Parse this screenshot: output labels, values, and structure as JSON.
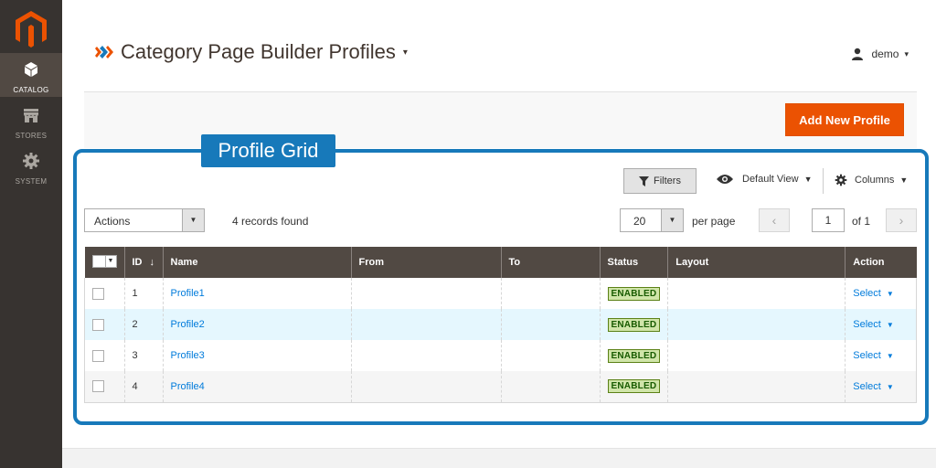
{
  "colors": {
    "sidebar": "#373330",
    "accent": "#eb5202",
    "grid_header": "#514943",
    "frame": "#1779ba",
    "link": "#007bdb",
    "badge": "#d0e5a9"
  },
  "sidebar": {
    "logo": "magento-logo-icon",
    "items": [
      {
        "label": "CATALOG",
        "icon": "cube-icon",
        "active": true
      },
      {
        "label": "STORES",
        "icon": "store-icon",
        "active": false
      },
      {
        "label": "SYSTEM",
        "icon": "gear-icon",
        "active": false
      }
    ]
  },
  "header": {
    "title": "Category Page Builder Profiles",
    "title_caret": "▾",
    "user": "demo",
    "user_caret": "▾"
  },
  "action_bar": {
    "add_button": "Add New Profile"
  },
  "annotation": {
    "label": "Profile Grid"
  },
  "toolbar": {
    "filters": "Filters",
    "view": "Default View",
    "columns": "Columns",
    "actions_select": "Actions",
    "records": "4 records found",
    "per_page_value": "20",
    "per_page_label": "per page",
    "prev": "‹",
    "next": "›",
    "page_value": "1",
    "page_of": "of 1"
  },
  "table": {
    "headers": [
      "",
      "ID",
      "Name",
      "From",
      "To",
      "Status",
      "Layout",
      "Action"
    ],
    "sort_indicator": "↓",
    "rows": [
      {
        "id": "1",
        "name": "Profile1",
        "from": "",
        "to": "",
        "status": "ENABLED",
        "layout": "",
        "action": "Select"
      },
      {
        "id": "2",
        "name": "Profile2",
        "from": "",
        "to": "",
        "status": "ENABLED",
        "layout": "",
        "action": "Select"
      },
      {
        "id": "3",
        "name": "Profile3",
        "from": "",
        "to": "",
        "status": "ENABLED",
        "layout": "",
        "action": "Select"
      },
      {
        "id": "4",
        "name": "Profile4",
        "from": "",
        "to": "",
        "status": "ENABLED",
        "layout": "",
        "action": "Select"
      }
    ]
  }
}
